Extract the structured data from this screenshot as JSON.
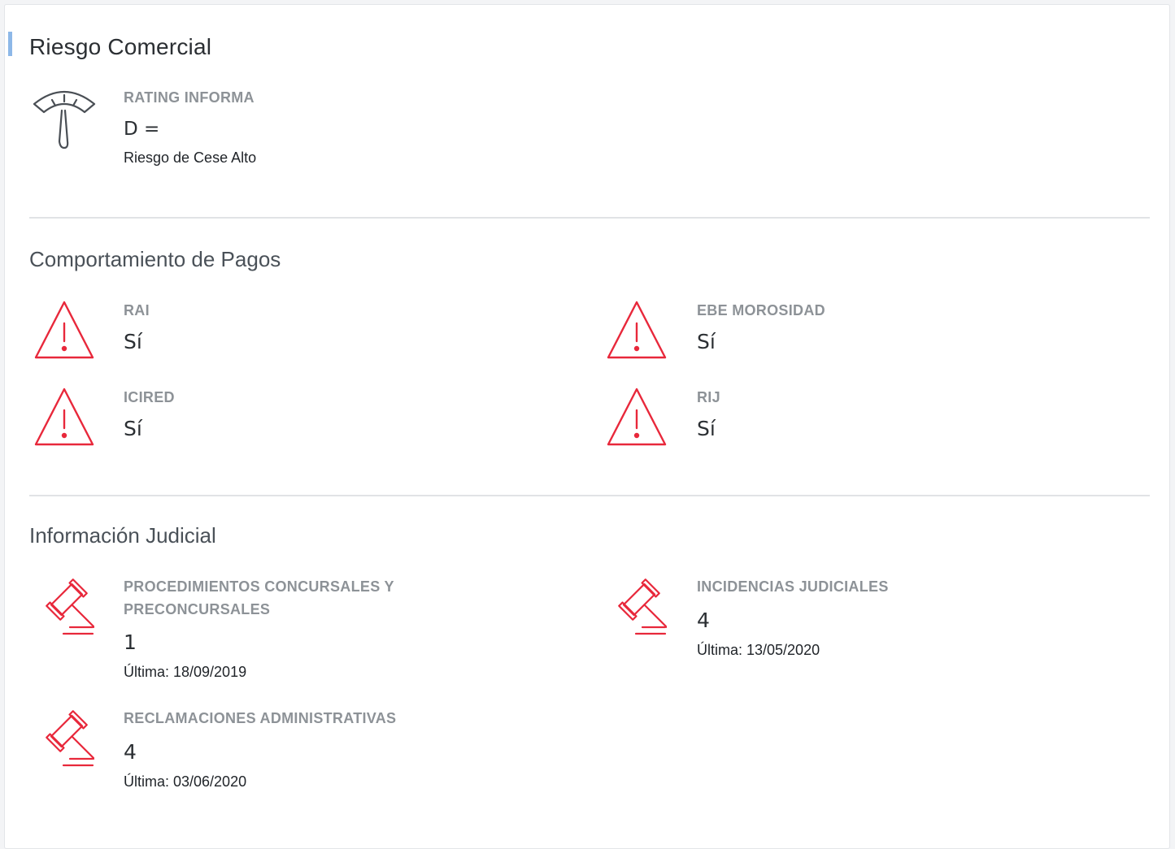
{
  "riesgo": {
    "title": "Riesgo Comercial",
    "rating_label": "RATING INFORMA",
    "rating_value": "D =",
    "rating_desc": "Riesgo de Cese Alto"
  },
  "pagos": {
    "title": "Comportamiento de Pagos",
    "items": [
      {
        "label": "RAI",
        "value": "Sí"
      },
      {
        "label": "EBE MOROSIDAD",
        "value": "Sí"
      },
      {
        "label": "ICIRED",
        "value": "Sí"
      },
      {
        "label": "RIJ",
        "value": "Sí"
      }
    ]
  },
  "judicial": {
    "title": "Información Judicial",
    "items": [
      {
        "label": "PROCEDIMIENTOS CONCURSALES Y PRECONCURSALES",
        "value": "1",
        "last": "Última: 18/09/2019"
      },
      {
        "label": "INCIDENCIAS JUDICIALES",
        "value": "4",
        "last": "Última: 13/05/2020"
      },
      {
        "label": "RECLAMACIONES ADMINISTRATIVAS",
        "value": "4",
        "last": "Última: 03/06/2020"
      }
    ]
  },
  "icons": {
    "rating": "gauge-icon",
    "alert": "warning-triangle-icon",
    "judicial": "gavel-icon"
  },
  "colors": {
    "alert": "#e8283b",
    "gauge": "#4a4f55",
    "accent": "#8db8e8"
  }
}
